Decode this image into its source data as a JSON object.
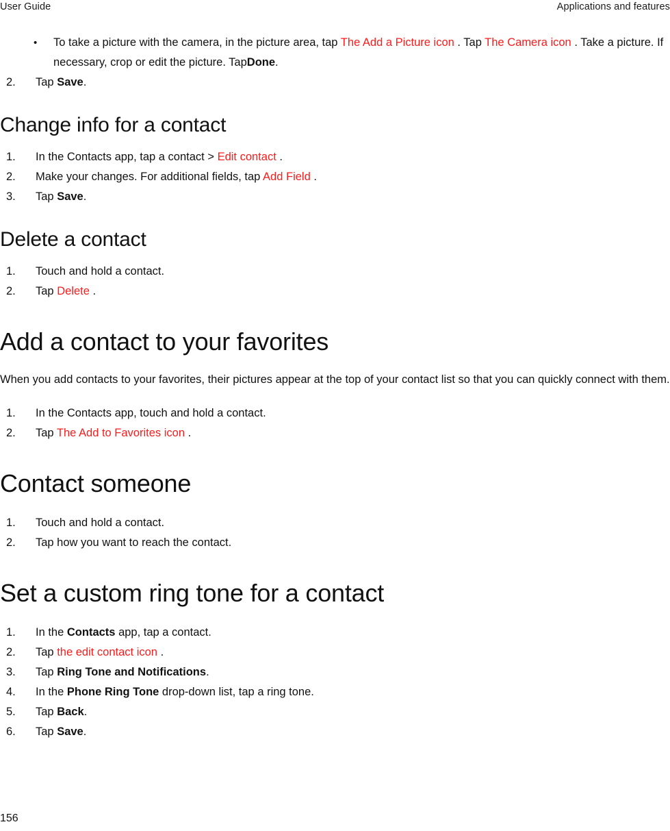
{
  "document": {
    "header": {
      "left": "User Guide",
      "right": "Applications and features"
    },
    "footer": {
      "page_number": "156"
    },
    "accent_color": "#f91c1c",
    "text_color": "#111111"
  },
  "continued_list": {
    "bullet": {
      "marker": "•",
      "part1": "To take a picture with the camera, in the picture area, tap",
      "ref1": "The Add a Picture icon",
      "part2": ". Tap",
      "ref2": "The Camera icon",
      "part3": ". Take a picture. If necessary, crop or edit the picture. Tap",
      "bold1": "Done",
      "part4": "."
    },
    "step2": {
      "num": "2.",
      "pre": "Tap",
      "bold": "Save",
      "post": "."
    }
  },
  "sections": [
    {
      "id": "change-info-for-a-contact",
      "heading": "Change info for a contact",
      "heading_level": "h2",
      "steps": [
        {
          "num": "1.",
          "pre": "In the Contacts app, tap a contact >",
          "ref": "Edit contact",
          "post": "."
        },
        {
          "num": "2.",
          "pre": "Make your changes. For additional fields, tap",
          "ref": "Add Field",
          "post": "."
        },
        {
          "num": "3.",
          "pre": "Tap",
          "bold": "Save",
          "post": "."
        }
      ]
    },
    {
      "id": "delete-a-contact",
      "heading": "Delete a contact",
      "heading_level": "h2",
      "steps": [
        {
          "num": "1.",
          "pre": "Touch and hold a contact."
        },
        {
          "num": "2.",
          "pre": "Tap",
          "ref": "Delete",
          "post": "."
        }
      ]
    },
    {
      "id": "add-a-contact-to-your-favorites",
      "heading": "Add a contact to your favorites",
      "heading_level": "h1",
      "intro": "When you add contacts to your favorites, their pictures appear at the top of your contact list so that you can quickly connect with them.",
      "steps": [
        {
          "num": "1.",
          "pre": "In the Contacts app, touch and hold a contact."
        },
        {
          "num": "2.",
          "pre": "Tap",
          "ref": "The Add to Favorites icon",
          "post": "."
        }
      ]
    },
    {
      "id": "contact-someone",
      "heading": "Contact someone",
      "heading_level": "h1",
      "steps": [
        {
          "num": "1.",
          "pre": "Touch and hold a contact."
        },
        {
          "num": "2.",
          "pre": "Tap how you want to reach the contact."
        }
      ]
    },
    {
      "id": "set-a-custom-ring-tone-for-a-contact",
      "heading": "Set a custom ring tone for a contact",
      "heading_level": "h1",
      "steps": [
        {
          "num": "1.",
          "pre": "In the",
          "bold": "Contacts",
          "post": " app, tap a contact."
        },
        {
          "num": "2.",
          "pre": "Tap",
          "ref": "the edit contact icon",
          "post": "."
        },
        {
          "num": "3.",
          "pre": "Tap",
          "bold": "Ring Tone and Notifications",
          "post": "."
        },
        {
          "num": "4.",
          "pre": "In the",
          "bold": "Phone Ring Tone",
          "post": " drop-down list, tap a ring tone."
        },
        {
          "num": "5.",
          "pre": "Tap",
          "bold": "Back",
          "post": "."
        },
        {
          "num": "6.",
          "pre": "Tap",
          "bold": "Save",
          "post": "."
        }
      ]
    }
  ]
}
